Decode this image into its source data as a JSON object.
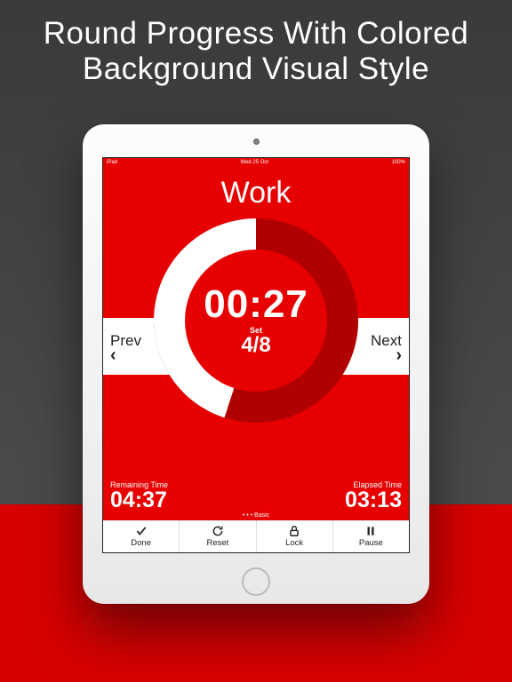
{
  "promo": {
    "title": "Round Progress  With Colored Background Visual Style"
  },
  "statusbar": {
    "left": "iPad",
    "center": "Wed 25 Oct",
    "right": "100%"
  },
  "phase": {
    "name": "Work"
  },
  "nav": {
    "prev_label": "Prev",
    "next_label": "Next"
  },
  "timer": {
    "time": "00:27",
    "set_label": "Set",
    "set_count": "4/8",
    "progress_deg": 162
  },
  "remaining": {
    "label": "Remaining Time",
    "value": "04:37"
  },
  "elapsed": {
    "label": "Elapsed Time",
    "value": "03:13"
  },
  "page_indicator": "• • • Basic",
  "toolbar": {
    "done": "Done",
    "reset": "Reset",
    "lock": "Lock",
    "pause": "Pause"
  },
  "colors": {
    "primary": "#e60000",
    "ring_dark": "#b00000",
    "progress": "#ffffff"
  },
  "chart_data": {
    "type": "pie",
    "title": "Interval progress ring",
    "series": [
      {
        "name": "elapsed",
        "value": 45,
        "color": "#ffffff"
      },
      {
        "name": "remaining",
        "value": 55,
        "color": "#b00000"
      }
    ],
    "center_time": "00:27",
    "set": "4/8"
  }
}
